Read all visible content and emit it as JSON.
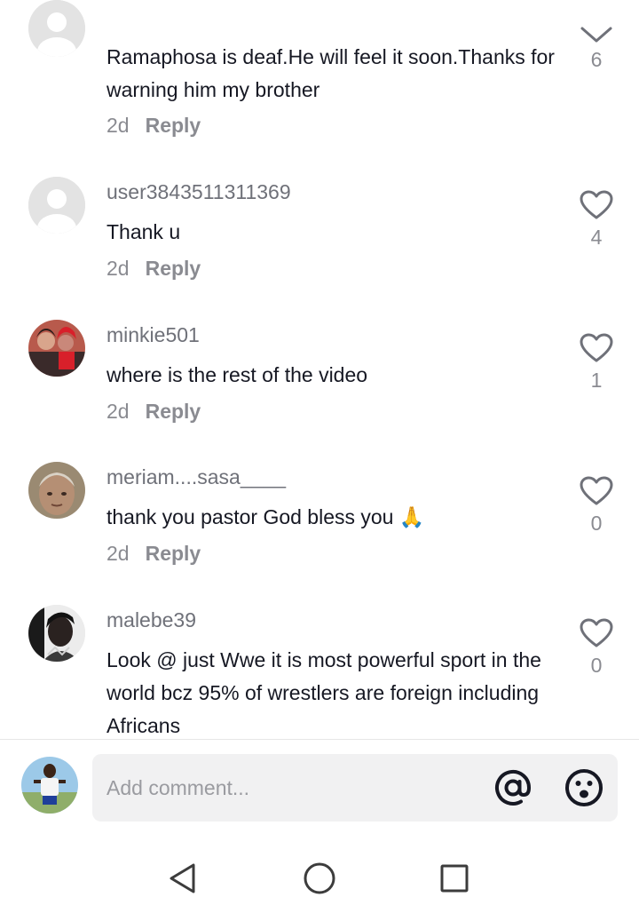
{
  "comments": [
    {
      "username": "",
      "text": "Ramaphosa is deaf.He will feel it soon.Thanks for warning him my brother",
      "age": "2d",
      "reply_label": "Reply",
      "likes": "6",
      "avatar_icon": "default-avatar-icon"
    },
    {
      "username": "user3843511311369",
      "text": "Thank u",
      "age": "2d",
      "reply_label": "Reply",
      "likes": "4",
      "avatar_icon": "default-avatar-icon"
    },
    {
      "username": "minkie501",
      "text": "where is the rest of the video",
      "age": "2d",
      "reply_label": "Reply",
      "likes": "1",
      "avatar_icon": "profile-photo"
    },
    {
      "username": "meriam....sasa____",
      "text": "thank you pastor God bless you 🙏",
      "age": "2d",
      "reply_label": "Reply",
      "likes": "0",
      "avatar_icon": "profile-photo"
    },
    {
      "username": "malebe39",
      "text": "Look @ just Wwe it is most powerful sport in the world bcz 95% of wrestlers are foreign including Africans",
      "age": "",
      "reply_label": "",
      "likes": "0",
      "avatar_icon": "profile-photo"
    }
  ],
  "composer": {
    "placeholder": "Add comment...",
    "mention_icon": "at-sign-icon",
    "emoji_icon": "emoji-icon"
  },
  "navbar": {
    "back_icon": "triangle-back-icon",
    "home_icon": "circle-home-icon",
    "recents_icon": "square-recents-icon"
  },
  "colors": {
    "text": "#161823",
    "muted": "#8a8b91",
    "input_bg": "#f1f1f2"
  }
}
